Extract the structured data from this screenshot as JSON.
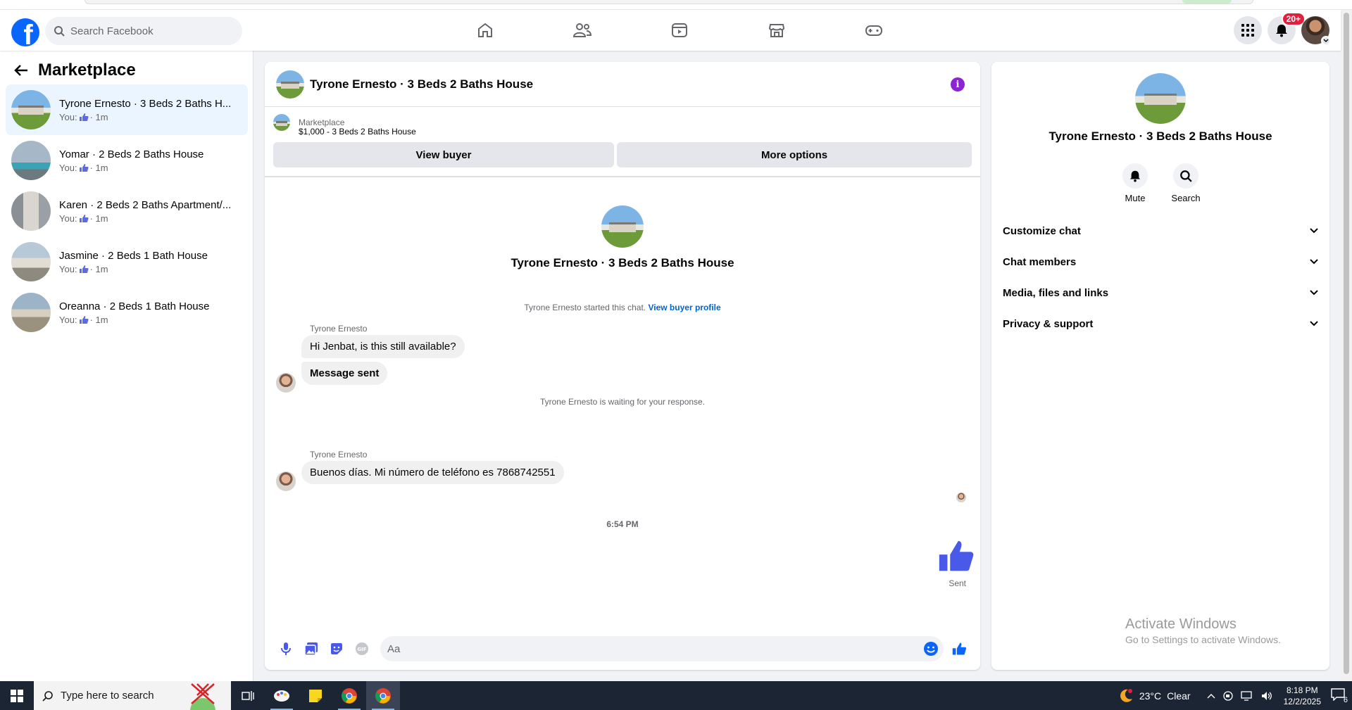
{
  "header": {
    "search_placeholder": "Search Facebook",
    "notification_count": "20+"
  },
  "sidebar": {
    "title": "Marketplace",
    "conversations": [
      {
        "name": "Tyrone Ernesto · 3 Beds 2 Baths H...",
        "you": "You:",
        "time": "· 1m"
      },
      {
        "name": "Yomar · 2 Beds 2 Baths House",
        "you": "You:",
        "time": "· 1m"
      },
      {
        "name": "Karen · 2 Beds 2 Baths Apartment/...",
        "you": "You:",
        "time": "· 1m"
      },
      {
        "name": "Jasmine · 2 Beds 1 Bath House",
        "you": "You:",
        "time": "· 1m"
      },
      {
        "name": "Oreanna · 2 Beds 1 Bath House",
        "you": "You:",
        "time": "· 1m"
      }
    ]
  },
  "chat": {
    "title": "Tyrone Ernesto · 3 Beds 2 Baths House",
    "marketplace_label": "Marketplace",
    "listing": "$1,000 - 3 Beds 2 Baths House",
    "view_buyer": "View buyer",
    "more_options": "More options",
    "intro_name": "Tyrone Ernesto · 3 Beds 2 Baths House",
    "started_text": "Tyrone Ernesto started this chat.",
    "view_profile": "View buyer profile",
    "sender1": "Tyrone Ernesto",
    "msg1": "Hi Jenbat, is this still available?",
    "msg2": "Message sent",
    "waiting": "Tyrone Ernesto is waiting for your response.",
    "sender2": "Tyrone Ernesto",
    "msg3": "Buenos días. Mi número de teléfono es 7868742551",
    "time": "6:54 PM",
    "sent_label": "Sent",
    "composer_placeholder": "Aa"
  },
  "info_panel": {
    "name": "Tyrone Ernesto · 3 Beds 2 Baths House",
    "mute": "Mute",
    "search": "Search",
    "sections": [
      "Customize chat",
      "Chat members",
      "Media, files and links",
      "Privacy & support"
    ]
  },
  "watermark": {
    "line1": "Activate Windows",
    "line2": "Go to Settings to activate Windows."
  },
  "taskbar": {
    "search_text": "Type here to search",
    "weather_temp": "23°C",
    "weather_desc": "Clear",
    "time": "8:18 PM",
    "date": "12/2/2025",
    "notif_count": "6"
  },
  "colors": {
    "brand_blue": "#0866ff",
    "like_blue": "#4a5ae8",
    "link_blue": "#0064d1"
  }
}
